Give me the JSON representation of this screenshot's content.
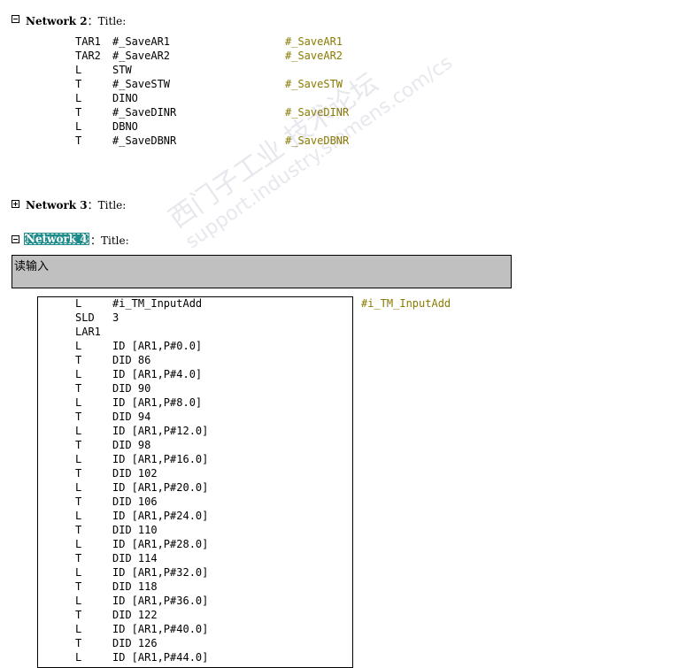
{
  "network2": {
    "label": "Network 2",
    "colon_title": "：Title:",
    "lines": [
      {
        "op": "TAR1",
        "arg": "#_SaveAR1",
        "sym": "#_SaveAR1"
      },
      {
        "op": "TAR2",
        "arg": "#_SaveAR2",
        "sym": "#_SaveAR2"
      },
      {
        "op": "L",
        "arg": "STW",
        "sym": ""
      },
      {
        "op": "T",
        "arg": "#_SaveSTW",
        "sym": "#_SaveSTW"
      },
      {
        "op": "L",
        "arg": "DINO",
        "sym": ""
      },
      {
        "op": "T",
        "arg": "#_SaveDINR",
        "sym": "#_SaveDINR"
      },
      {
        "op": "L",
        "arg": "DBNO",
        "sym": ""
      },
      {
        "op": "T",
        "arg": "#_SaveDBNR",
        "sym": "#_SaveDBNR"
      }
    ]
  },
  "network3": {
    "label": "Network 3",
    "colon_title": "：Title:"
  },
  "network4": {
    "label": "Network 4",
    "colon_title": "：Title:",
    "comment": "读输入",
    "symbol_hint": "#i_TM_InputAdd",
    "lines": [
      {
        "op": "L",
        "arg": "#i_TM_InputAdd"
      },
      {
        "op": "SLD",
        "arg": "3"
      },
      {
        "op": "LAR1",
        "arg": ""
      },
      {
        "op": "L",
        "arg": "ID [AR1,P#0.0]"
      },
      {
        "op": "T",
        "arg": "DID   86"
      },
      {
        "op": "L",
        "arg": "ID [AR1,P#4.0]"
      },
      {
        "op": "T",
        "arg": "DID   90"
      },
      {
        "op": "L",
        "arg": "ID [AR1,P#8.0]"
      },
      {
        "op": "T",
        "arg": "DID   94"
      },
      {
        "op": "L",
        "arg": "ID [AR1,P#12.0]"
      },
      {
        "op": "T",
        "arg": "DID   98"
      },
      {
        "op": "L",
        "arg": "ID [AR1,P#16.0]"
      },
      {
        "op": "T",
        "arg": "DID  102"
      },
      {
        "op": "L",
        "arg": "ID [AR1,P#20.0]"
      },
      {
        "op": "T",
        "arg": "DID  106"
      },
      {
        "op": "L",
        "arg": "ID [AR1,P#24.0]"
      },
      {
        "op": "T",
        "arg": "DID  110"
      },
      {
        "op": "L",
        "arg": "ID [AR1,P#28.0]"
      },
      {
        "op": "T",
        "arg": "DID  114"
      },
      {
        "op": "L",
        "arg": "ID [AR1,P#32.0]"
      },
      {
        "op": "T",
        "arg": "DID  118"
      },
      {
        "op": "L",
        "arg": "ID [AR1,P#36.0]"
      },
      {
        "op": "T",
        "arg": "DID  122"
      },
      {
        "op": "L",
        "arg": "ID [AR1,P#40.0]"
      },
      {
        "op": "T",
        "arg": "DID  126"
      },
      {
        "op": "L",
        "arg": "ID [AR1,P#44.0]"
      }
    ]
  },
  "watermark": {
    "line1": "西门子工业 技术论坛",
    "line2": "support.industry.siemens.com/cs"
  }
}
